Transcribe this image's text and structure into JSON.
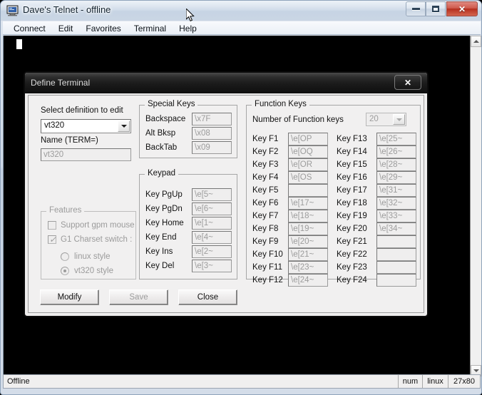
{
  "window": {
    "title": "Dave's Telnet - offline",
    "icon": "terminal-monitor-icon",
    "controls": {
      "minimize": "minimize-icon",
      "maximize": "maximize-icon",
      "close": "✕"
    }
  },
  "menubar": {
    "items": [
      {
        "label": "Connect"
      },
      {
        "label": "Edit"
      },
      {
        "label": "Favorites"
      },
      {
        "label": "Terminal"
      },
      {
        "label": "Help"
      }
    ]
  },
  "statusbar": {
    "message": "Offline",
    "num": "num",
    "terminal": "linux",
    "size": "27x80"
  },
  "dialog": {
    "title": "Define Terminal",
    "close_label": "✕",
    "definition": {
      "select_label": "Select definition to edit",
      "selected": "vt320",
      "name_label": "Name (TERM=)",
      "name_value": "vt320"
    },
    "features": {
      "title": "Features",
      "gpm_label": "Support gpm mouse",
      "gpm_checked": false,
      "charset_label": "G1 Charset switch :",
      "charset_checked": true,
      "radios": [
        {
          "label": "linux style",
          "selected": false
        },
        {
          "label": "vt320 style",
          "selected": true
        }
      ]
    },
    "special_keys": {
      "title": "Special Keys",
      "rows": [
        {
          "label": "Backspace",
          "value": "\\x7F"
        },
        {
          "label": "Alt Bksp",
          "value": "\\x08"
        },
        {
          "label": "BackTab",
          "value": "\\x09"
        }
      ]
    },
    "keypad": {
      "title": "Keypad",
      "rows": [
        {
          "label": "Key PgUp",
          "value": "\\e[5~"
        },
        {
          "label": "Key PgDn",
          "value": "\\e[6~"
        },
        {
          "label": "Key Home",
          "value": "\\e[1~"
        },
        {
          "label": "Key End",
          "value": "\\e[4~"
        },
        {
          "label": "Key Ins",
          "value": "\\e[2~"
        },
        {
          "label": "Key Del",
          "value": "\\e[3~"
        }
      ]
    },
    "function_keys": {
      "title": "Function Keys",
      "count_label": "Number of Function keys",
      "count_value": "20",
      "left_column": [
        {
          "label": "Key F1",
          "value": "\\e[OP"
        },
        {
          "label": "Key F2",
          "value": "\\e[OQ"
        },
        {
          "label": "Key F3",
          "value": "\\e[OR"
        },
        {
          "label": "Key F4",
          "value": "\\e[OS"
        },
        {
          "label": "Key F5",
          "value": ""
        },
        {
          "label": "Key F6",
          "value": "\\e[17~"
        },
        {
          "label": "Key F7",
          "value": "\\e[18~"
        },
        {
          "label": "Key F8",
          "value": "\\e[19~"
        },
        {
          "label": "Key F9",
          "value": "\\e[20~"
        },
        {
          "label": "Key F10",
          "value": "\\e[21~"
        },
        {
          "label": "Key F11",
          "value": "\\e[23~"
        },
        {
          "label": "Key F12",
          "value": "\\e[24~"
        }
      ],
      "right_column": [
        {
          "label": "Key F13",
          "value": "\\e[25~"
        },
        {
          "label": "Key F14",
          "value": "\\e[26~"
        },
        {
          "label": "Key F15",
          "value": "\\e[28~"
        },
        {
          "label": "Key F16",
          "value": "\\e[29~"
        },
        {
          "label": "Key F17",
          "value": "\\e[31~"
        },
        {
          "label": "Key F18",
          "value": "\\e[32~"
        },
        {
          "label": "Key F19",
          "value": "\\e[33~"
        },
        {
          "label": "Key F20",
          "value": "\\e[34~"
        },
        {
          "label": "Key F21",
          "value": ""
        },
        {
          "label": "Key F22",
          "value": ""
        },
        {
          "label": "Key F23",
          "value": ""
        },
        {
          "label": "Key F24",
          "value": ""
        }
      ]
    },
    "buttons": [
      {
        "label": "Modify",
        "enabled": true
      },
      {
        "label": "Save",
        "enabled": false
      },
      {
        "label": "Close",
        "enabled": true
      }
    ]
  },
  "colors": {
    "terminal_bg": "#000000",
    "dialog_bg": "#f1f0f0",
    "dialog_titlebar": "#1a1a1a",
    "close_button_red": "#b52f1e"
  }
}
